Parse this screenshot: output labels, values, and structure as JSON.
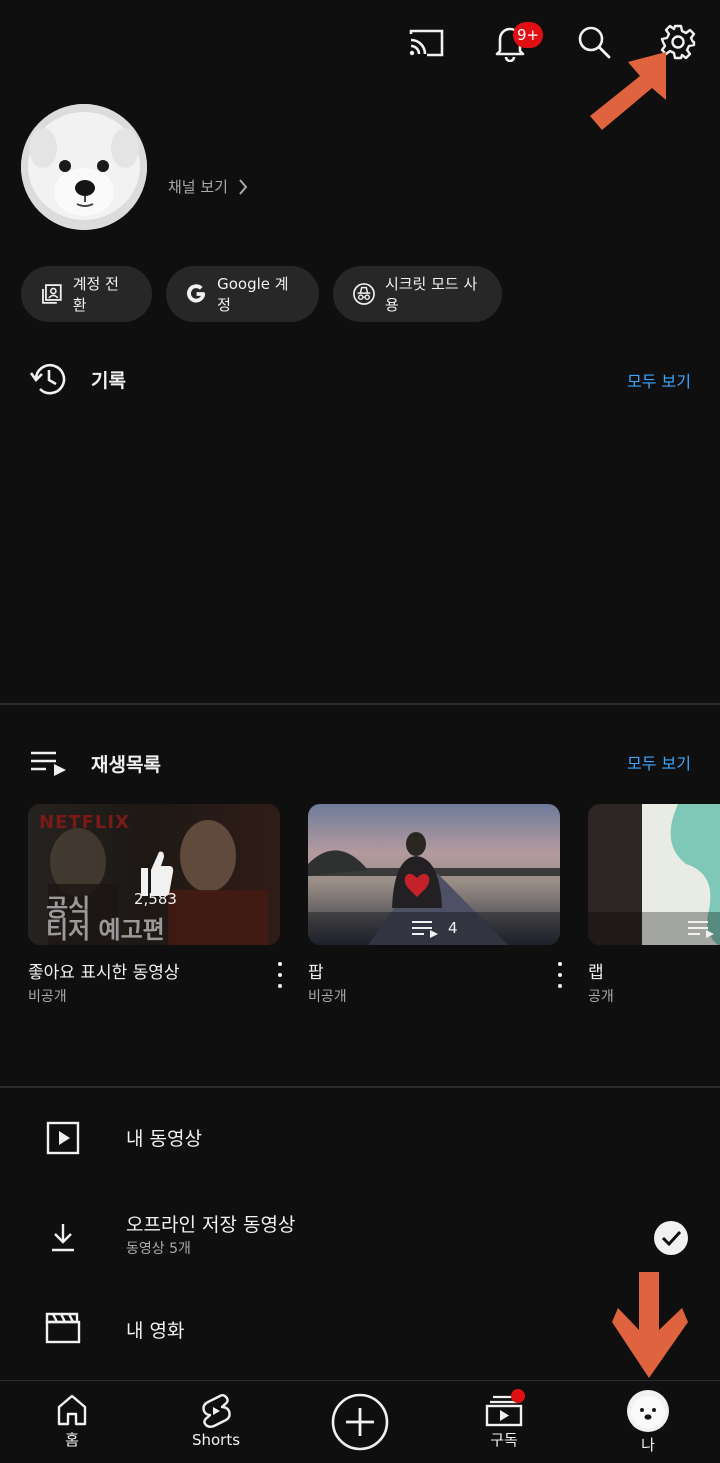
{
  "top_bar": {
    "cast_icon": "cast-icon",
    "notifications_icon": "bell-icon",
    "notification_badge": "9+",
    "search_icon": "search-icon",
    "settings_icon": "gear-icon"
  },
  "profile": {
    "channel_link_label": "채널 보기"
  },
  "chips": [
    {
      "label": "계정 전환",
      "icon": "switch-account-icon"
    },
    {
      "label": "Google 계정",
      "icon": "google-icon"
    },
    {
      "label": "시크릿 모드 사용",
      "icon": "incognito-icon"
    }
  ],
  "history": {
    "title": "기록",
    "see_all": "모두 보기"
  },
  "playlists": {
    "title": "재생목록",
    "see_all": "모두 보기",
    "items": [
      {
        "title": "좋아요 표시한 동영상",
        "privacy": "비공개",
        "like_count": "2,583",
        "thumb_text_1": "공식",
        "thumb_text_2": "티저 예고편",
        "thumb_brand": "NETFLIX"
      },
      {
        "title": "팝",
        "privacy": "비공개",
        "video_count": "4"
      },
      {
        "title": "랩",
        "privacy": "공개"
      }
    ]
  },
  "library": {
    "my_videos": "내 동영상",
    "offline": "오프라인 저장 동영상",
    "offline_sub": "동영상 5개",
    "my_movies": "내 영화"
  },
  "bottom_nav": {
    "home": "홈",
    "shorts": "Shorts",
    "subscriptions": "구독",
    "you": "나"
  },
  "colors": {
    "background": "#0f0f0f",
    "chip": "#272727",
    "link": "#3ea6ff",
    "badge": "#e00f14",
    "annotation_arrow": "#e0633f"
  }
}
